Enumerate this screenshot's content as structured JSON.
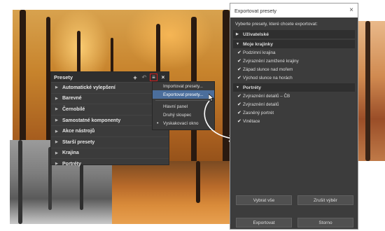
{
  "presets_panel": {
    "title": "Presety",
    "items": [
      {
        "label": "Automatické vylepšení"
      },
      {
        "label": "Barevné"
      },
      {
        "label": "Černobílé"
      },
      {
        "label": "Samostatné komponenty"
      },
      {
        "label": "Akce nástrojů"
      },
      {
        "label": "Starší presety"
      },
      {
        "label": "Krajina"
      },
      {
        "label": "Portréty"
      }
    ]
  },
  "dropdown_menu": {
    "items": [
      {
        "label": "Importovat presety..."
      },
      {
        "label": "Exportovat presety..."
      },
      {
        "label": "Hlavní panel"
      },
      {
        "label": "Druhý sloupec"
      },
      {
        "label": "Vyskakovací okno"
      }
    ]
  },
  "export_dialog": {
    "title": "Exportovat presety",
    "instruction": "Vyberte presety, které chcete exportovat:",
    "groups": [
      {
        "label": "Uživatelské",
        "items": []
      },
      {
        "label": "Moje krajinky",
        "items": [
          {
            "label": "Podzimní krajina",
            "checked": "✔"
          },
          {
            "label": "Zvýraznění zamlžené krajiny",
            "checked": "✔"
          },
          {
            "label": "Západ slunce nad mořem",
            "checked": "✔"
          },
          {
            "label": "Východ slunce na horách",
            "checked": "✔"
          }
        ]
      },
      {
        "label": "Portréty",
        "items": [
          {
            "label": "Zvýraznění detailů – ČB",
            "checked": "✔"
          },
          {
            "label": "Zvýraznění detailů",
            "checked": "✔"
          },
          {
            "label": "Zasněný portrét",
            "checked": "✔"
          },
          {
            "label": "Viněta​ce",
            "checked": "✔"
          }
        ]
      }
    ],
    "select_all": "Vybrat vše",
    "deselect": "Zrušit výběr",
    "export_button": "Exportovat",
    "cancel_button": "Storno"
  },
  "colors": {
    "highlight": "#4b6e9c",
    "menu_button_border": "#d02020"
  }
}
